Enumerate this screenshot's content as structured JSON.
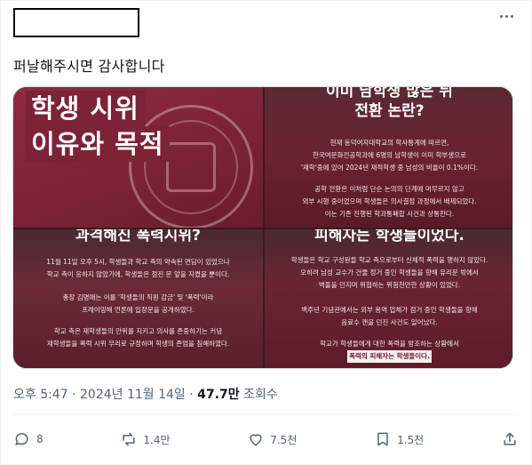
{
  "tweet": {
    "text": "퍼날해주시면 감사합니다",
    "timestamp": "오후 5:47 · 2024년 11월 14일",
    "dot": "·",
    "views_count": "47.7만",
    "views_label": "조회수"
  },
  "actions": {
    "reply": "8",
    "retweet": "1.4만",
    "like": "7.5천",
    "bookmark": "1.5천"
  },
  "media": {
    "tile1": {
      "line1": "학생 시위",
      "line2": "이유와 목적"
    },
    "tile2": {
      "head1": "이미 남학생 많은 뒤",
      "head2": "전환 논란?",
      "p1a": "현재 동덕여자대학교의 학사통계에 따르면,",
      "p1b": "한국여문화전공학과에 6명의 남학생이 이미 학부생으로",
      "p1c": "'재학'중에 있어 2024년 재적학생 중 남성의 비율이 0.1%이다.",
      "p2a": "공학 전환은 이처럼 단순 논의의 단계에 머무르지 않고",
      "p2b": "외부 시행 중이었으며 학생들은 의사결정 과정에서 배제되었다.",
      "p2c": "이는 기존 진행된 학과통폐합 사건과 상통한다."
    },
    "tile3": {
      "head": "과격해진 폭력시위?",
      "p1a": "11월 11일 오후 5시, 학생들과 학교 측의 약속된 면담이 있었으나",
      "p1b": "학교 측이 응하지 않았기에, 학생들은 점진 문 앞을 지켰을 뿐이다.",
      "p2a": "총장 김명애는 이를 '학생들의 직원 감금' 및 '폭력'이라",
      "p2b": "프레이밍해 언론에 입장문을 공개하였다.",
      "p3a": "학교 측은 재학생들의 안위를 지키고 의사를 존중하기는 커녕",
      "p3b": "재학생들을 폭력 시위 무리로 규정하며 학생의 존엄을 침해하였다."
    },
    "tile4": {
      "head": "피해자는 학생들이었다.",
      "p1a": "학생들은 학교 구성원들 학교 측으로부터 신체적 폭력을 행하지 않았다.",
      "p1b": "오히려 남성 교수가 건물 정거 중인 학생들을 향해 유리문 밖에서",
      "p1c": "벽돌을 던지며 위협하는 위험천만한 상황이 있었다.",
      "p2a": "백주년 기념관에서는 외부 용역 업체가 점거 중인 학생들을 향해",
      "p2b": "음료수 캔을 던진 사건도 일어났다.",
      "p3a": "학교가 학생들에게 대한 폭력을 방조하는 상황에서",
      "p3b": "폭력의 피해자는 학생들이다."
    }
  },
  "icons": {
    "more": "more-dots-icon",
    "reply": "reply-bubble-icon",
    "retweet": "retweet-icon",
    "like": "heart-icon",
    "bookmark": "bookmark-icon",
    "share": "share-upload-icon"
  },
  "colors": {
    "text": "#0f1419",
    "muted": "#536471",
    "tile_red": "#7d2337"
  }
}
